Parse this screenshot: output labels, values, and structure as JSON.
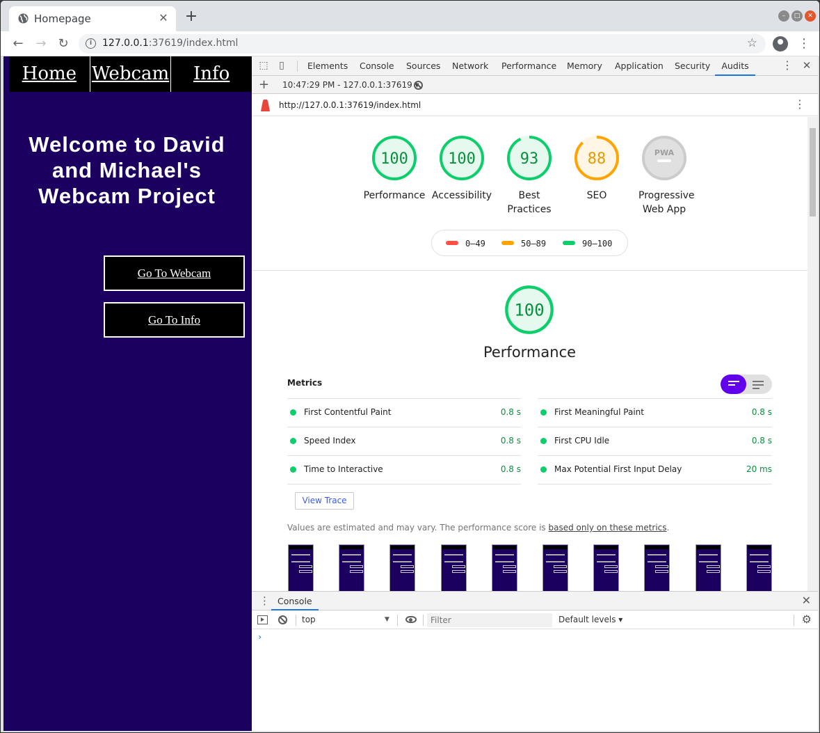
{
  "browser": {
    "tab_title": "Homepage",
    "tab_close": "✕",
    "new_tab": "+",
    "url_host": "127.0.0.1",
    "url_rest": ":37619/index.html",
    "icons": [
      "back-icon",
      "forward-icon",
      "reload-icon",
      "info-icon",
      "star-icon",
      "account-icon",
      "menu-icon"
    ]
  },
  "site": {
    "nav": [
      "Home",
      "Webcam",
      "Info"
    ],
    "welcome": "Welcome to David and Michael's Webcam Project",
    "button_webcam": "Go To Webcam",
    "button_info": "Go To Info",
    "colors": {
      "background": "#1c0060",
      "nav": "#000000",
      "text": "#ffffff"
    }
  },
  "devtools": {
    "tabs": [
      "Elements",
      "Console",
      "Sources",
      "Network",
      "Performance",
      "Memory",
      "Application",
      "Security",
      "Audits"
    ],
    "active_tab": "Audits",
    "audit_run": "10:47:29 PM - 127.0.0.1:37619 ▾",
    "report_url": "http://127.0.0.1:37619/index.html"
  },
  "report": {
    "gauges": [
      {
        "label": "Performance",
        "score": "100",
        "fraction": 1.0,
        "color": "#0cce6b",
        "text_color": "#0a8f3e",
        "bg": "#e6f9ef"
      },
      {
        "label": "Accessibility",
        "score": "100",
        "fraction": 1.0,
        "color": "#0cce6b",
        "text_color": "#0a8f3e",
        "bg": "#e6f9ef"
      },
      {
        "label": "Best Practices",
        "score": "93",
        "fraction": 0.93,
        "color": "#0cce6b",
        "text_color": "#0a8f3e",
        "bg": "#e6f9ef"
      },
      {
        "label": "SEO",
        "score": "88",
        "fraction": 0.88,
        "color": "#ffa400",
        "text_color": "#e39b00",
        "bg": "#fff6e5"
      },
      {
        "label": "Progressive Web App",
        "score": "PWA",
        "fraction": 0,
        "color": "#cccccc",
        "text_color": "#ffffff",
        "bg": "#e0e0e0"
      }
    ],
    "legend": [
      {
        "range": "0–49",
        "color": "#ff4e42"
      },
      {
        "range": "50–89",
        "color": "#ffa400"
      },
      {
        "range": "90–100",
        "color": "#0cce6b"
      }
    ],
    "perf_score": "100",
    "perf_title": "Performance",
    "metrics_heading": "Metrics",
    "metrics": [
      {
        "name": "First Contentful Paint",
        "value": "0.8 s"
      },
      {
        "name": "First Meaningful Paint",
        "value": "0.8 s"
      },
      {
        "name": "Speed Index",
        "value": "0.8 s"
      },
      {
        "name": "First CPU Idle",
        "value": "0.8 s"
      },
      {
        "name": "Time to Interactive",
        "value": "0.8 s"
      },
      {
        "name": "Max Potential First Input Delay",
        "value": "20 ms"
      }
    ],
    "view_trace": "View Trace",
    "note_before": "Values are estimated and may vary. The performance score is ",
    "note_link": "based only on these metrics",
    "note_after": ".",
    "filmstrip_count": 10
  },
  "console": {
    "tab": "Console",
    "context": "top",
    "filter_placeholder": "Filter",
    "levels": "Default levels ▾",
    "prompt": "›"
  }
}
